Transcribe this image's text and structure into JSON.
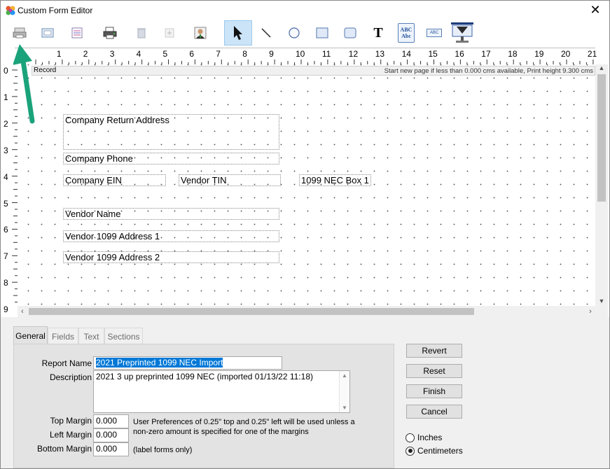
{
  "window": {
    "title": "Custom Form Editor",
    "close_symbol": "✕"
  },
  "toolbar": {
    "items": [
      {
        "icon": "print-setup-icon"
      },
      {
        "icon": "page-setup-icon"
      },
      {
        "icon": "section-icon"
      },
      {
        "icon": "printer-icon"
      },
      {
        "icon": "delete-icon"
      },
      {
        "icon": "add-icon"
      },
      {
        "icon": "user-icon"
      },
      {
        "icon": "select-pointer-icon",
        "active": true
      },
      {
        "icon": "line-tool-icon"
      },
      {
        "icon": "ellipse-tool-icon"
      },
      {
        "icon": "rectangle-tool-icon"
      },
      {
        "icon": "rounded-rectangle-tool-icon"
      },
      {
        "icon": "text-tool-icon"
      },
      {
        "icon": "field-text-tool-icon"
      },
      {
        "icon": "label-tool-icon"
      },
      {
        "icon": "image-tool-icon"
      }
    ],
    "text_tool_glyph": "T",
    "field_tool_text": "ABC Abc",
    "label_tool_text": "ABC"
  },
  "ruler": {
    "horizontal": [
      "1",
      "2",
      "3",
      "4",
      "5",
      "6",
      "7",
      "8",
      "9",
      "10",
      "11",
      "12",
      "13",
      "14",
      "15",
      "16",
      "17",
      "18",
      "19",
      "20",
      "21"
    ],
    "vertical": [
      "0",
      "1",
      "2",
      "3",
      "4",
      "5",
      "6",
      "7",
      "8",
      "9"
    ]
  },
  "canvas": {
    "section_label": "Record",
    "section_info": "Start new page if less than 0.000 cms available, Print height 9.300 cms",
    "fields": [
      "Company Return Address",
      "Company Phone",
      "Company EIN",
      "Vendor TIN",
      "1099 NEC Box 1",
      "Vendor Name",
      "Vendor 1099 Address 1",
      "Vendor 1099 Address 2"
    ]
  },
  "tabs": [
    "General",
    "Fields",
    "Text",
    "Sections"
  ],
  "general": {
    "report_name_label": "Report Name",
    "report_name_value": "2021 Preprinted 1099 NEC Import",
    "description_label": "Description",
    "description_value": "2021 3 up preprinted 1099 NEC (imported 01/13/22 11:18)",
    "top_margin_label": "Top Margin",
    "top_margin_value": "0.000",
    "left_margin_label": "Left Margin",
    "left_margin_value": "0.000",
    "bottom_margin_label": "Bottom Margin",
    "bottom_margin_value": "0.000",
    "margin_note": "User Preferences of 0.25\" top and 0.25\" left will be used unless a non-zero amount is specified for one of the margins",
    "label_forms_note": "(label forms only)"
  },
  "buttons": {
    "revert": "Revert",
    "reset": "Reset",
    "finish": "Finish",
    "cancel": "Cancel"
  },
  "units": {
    "inches": "Inches",
    "centimeters": "Centimeters",
    "selected": "centimeters"
  },
  "colors": {
    "annotation_arrow": "#1aa37a",
    "selection": "#0078d7",
    "active_tool": "#cce4f7"
  }
}
